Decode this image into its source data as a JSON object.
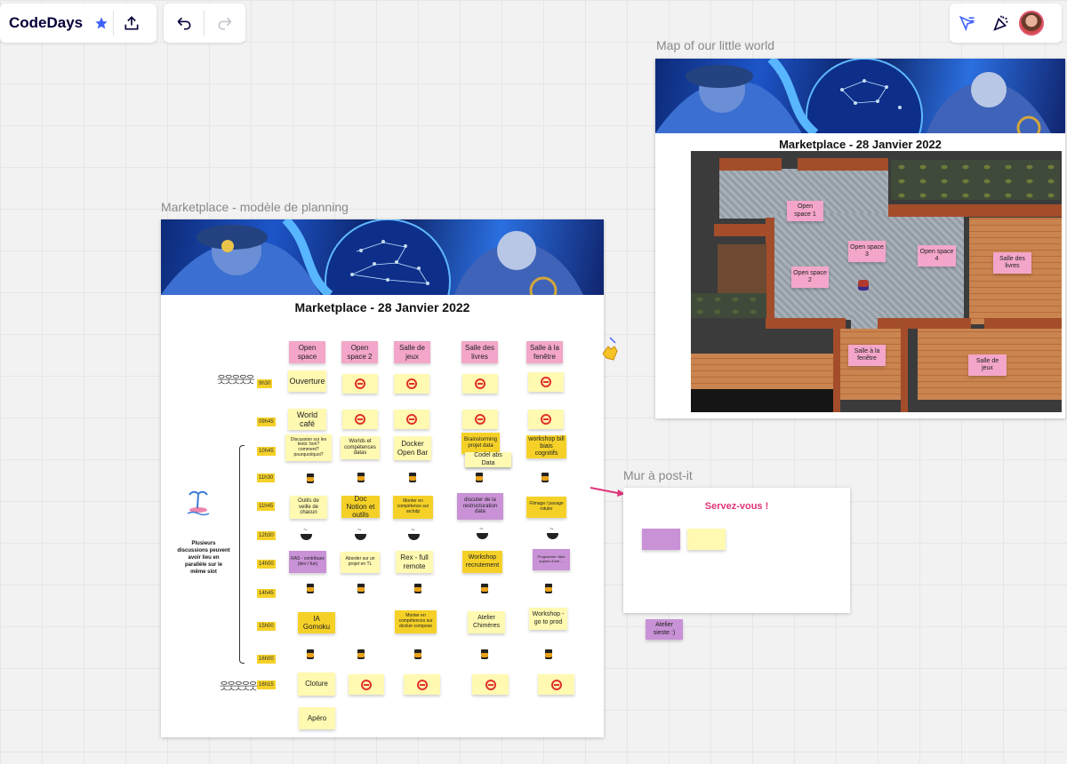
{
  "board": {
    "title": "CodeDays",
    "colors": {
      "accent": "#4262ff",
      "pink_arrow": "#e0357a",
      "canvas": "#f2f2f2"
    }
  },
  "toolbar": {
    "star_icon": "star-icon",
    "share_icon": "upload-icon",
    "undo_icon": "undo-icon",
    "redo_icon": "redo-icon",
    "filter_icon": "filter-icon",
    "celebrate_icon": "party-popper-icon"
  },
  "planning": {
    "label": "Marketplace - modèle de planning",
    "title": "Marketplace - 28 Janvier 2022",
    "rooms": [
      "Open space",
      "Open space 2",
      "Salle de jeux",
      "Salle des livres",
      "Salle à la fenêtre"
    ],
    "times": [
      "9h30",
      "09h45",
      "10h45",
      "11h30",
      "11h45",
      "12h30",
      "14h00",
      "14h45",
      "15h00",
      "16h00",
      "16h15"
    ],
    "side_note": "Plusieurs discussions peuvent avoir lieu en parallèle sur le même slot",
    "rows": {
      "r1": "Ouverture",
      "r2": "World café",
      "r3": [
        "Discussion sur les tests: bon? comment? pourquoi/quoi?",
        "Worlds et compétences datas",
        "Docker Open Bar",
        "Brainstorming projet data",
        "workshop bill biais cognitifs"
      ],
      "r3_extra": "Codel abs Data",
      "r4": [
        "Outils de veille de chacun",
        "Doc Notion et outils",
        "Monter en compétence sur archdp",
        "discuter de la restructuration data",
        "Filmage / pavage rotuler"
      ],
      "r5": [
        "RAS - contribuez (dev / fun)",
        "Aborder sur un projet en TL",
        "Rex - full remote",
        "Workshop recrutement",
        "Programme: faire auprès d'une ..."
      ],
      "r6": [
        "IA Gomoku",
        "Monter en compétences sur docker-compose",
        "Atelier Chimères",
        "Workshop - go to prod"
      ],
      "r7": "Cloture",
      "r8": "Apéro"
    }
  },
  "map_frame": {
    "label": "Map of our little world",
    "title": "Marketplace - 28 Janvier 2022",
    "rooms": [
      "Open space 1",
      "Open space 3",
      "Open space 4",
      "Open space 2",
      "Salle des livres",
      "Salle à la fenêtre",
      "Salle de jeux"
    ]
  },
  "postit_wall": {
    "label": "Mur à post-it",
    "heading": "Servez-vous !",
    "outside_note": "Atelier sieste :)"
  }
}
